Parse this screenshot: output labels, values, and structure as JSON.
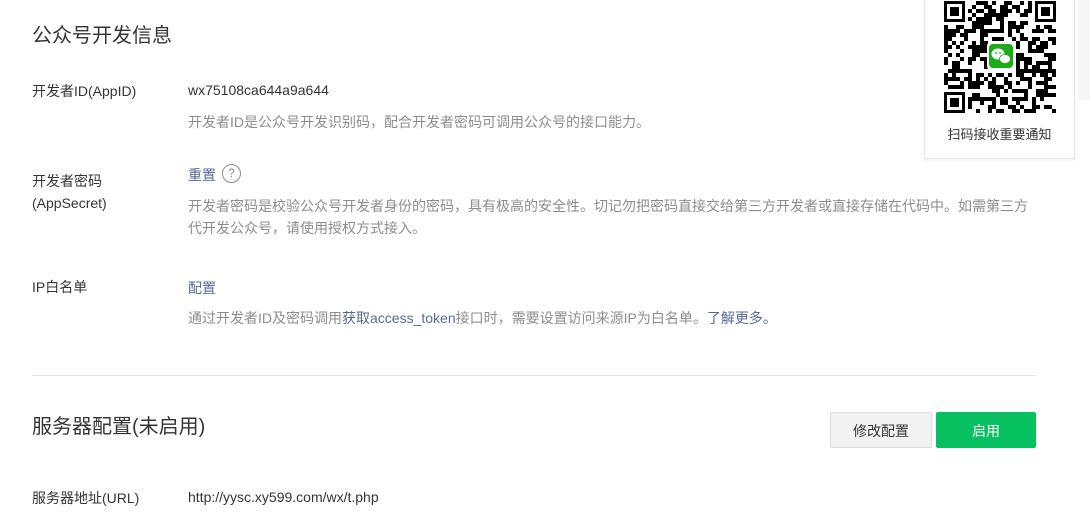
{
  "section1": {
    "title": "公众号开发信息",
    "appid": {
      "label": "开发者ID(AppID)",
      "value": "wx75108ca644a9a644",
      "desc": "开发者ID是公众号开发识别码，配合开发者密码可调用公众号的接口能力。"
    },
    "secret": {
      "label_line1": "开发者密码",
      "label_line2": "(AppSecret)",
      "action": "重置",
      "help_icon": "question-circle",
      "desc_line1": "开发者密码是校验公众号开发者身份的密码，具有极高的安全性。切记勿把密码直接交给第三方开发者或直接存储在代码中。如需第三方",
      "desc_line2": "代开发公众号，请使用授权方式接入。"
    },
    "ip_whitelist": {
      "label": "IP白名单",
      "action": "配置",
      "desc_prefix": "通过开发者ID及密码调用",
      "desc_link": "获取access_token",
      "desc_middle": "接口时，需要设置访问来源IP为白名单。",
      "desc_more": "了解更多。"
    }
  },
  "section2": {
    "title": "服务器配置(未启用)",
    "modify_button": "修改配置",
    "enable_button": "启用",
    "url": {
      "label": "服务器地址(URL)",
      "value": "http://yysc.xy599.com/wx/t.php"
    }
  },
  "qr_card": {
    "caption": "扫码接收重要通知",
    "center_icon": "wechat-logo"
  },
  "colors": {
    "link": "#576b95",
    "primary": "#07c160",
    "muted": "#8d8d8d",
    "text": "#353535"
  }
}
